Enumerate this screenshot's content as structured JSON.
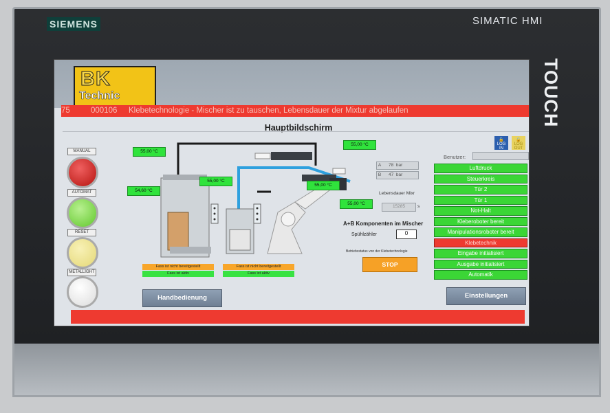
{
  "device": {
    "brand": "SIEMENS",
    "model": "SIMATIC HMI",
    "touch_label": "TOUCH"
  },
  "logo": {
    "line1": "BK",
    "line2": "Technic"
  },
  "alarm": {
    "number": "75",
    "code": "000106",
    "text": "Klebetechnologie - Mischer ist zu tauschen, Lebensdauer der Mixtur abgelaufen"
  },
  "screen_title": "Hauptbildschirm",
  "side_lamps": [
    {
      "label": "MANUAL",
      "color": "#d02020"
    },
    {
      "label": "AUTOMAT",
      "color": "#7ee048"
    },
    {
      "label": "RESET",
      "color": "#f0e69a"
    },
    {
      "label": "METALLIGHT",
      "color": "#f4f4f4"
    }
  ],
  "temperatures": [
    {
      "id": "t1",
      "value": "55,00",
      "unit": "°C"
    },
    {
      "id": "t2",
      "value": "54,60",
      "unit": "°C"
    },
    {
      "id": "t3",
      "value": "55,00",
      "unit": "°C"
    },
    {
      "id": "t4",
      "value": "55,00",
      "unit": "°C"
    },
    {
      "id": "t5",
      "value": "55,00",
      "unit": "°C"
    },
    {
      "id": "t6",
      "value": "55,00",
      "unit": "°C"
    }
  ],
  "pressure": [
    {
      "label": "A",
      "value": "78",
      "unit": "bar"
    },
    {
      "label": "B",
      "value": "47",
      "unit": "bar"
    }
  ],
  "mixer": {
    "life_label": "Lebensdauer Mixr",
    "life_value": "15285",
    "life_unit": "s",
    "components_label": "A+B Komponenten im Mischer",
    "flush_label": "Spühlzähler",
    "flush_value": "0",
    "operation_label": "Betriebsstatus von der Klebetechnologie",
    "stop_label": "STOP"
  },
  "barrels": [
    {
      "status1": "Fass ist nicht bereitgestellt",
      "status2": "Fass ist aktiv"
    },
    {
      "status1": "Fass ist nicht bereitgestellt",
      "status2": "Fass ist aktiv"
    }
  ],
  "user": {
    "label": "Benutzer:",
    "value": ""
  },
  "login": {
    "login_label": "LOG IN",
    "logout_label": "LOG OUT"
  },
  "status_list": [
    {
      "label": "Luftdruck",
      "state": "ok"
    },
    {
      "label": "Steuerkreis",
      "state": "ok"
    },
    {
      "label": "Tür 2",
      "state": "ok"
    },
    {
      "label": "Tür 1",
      "state": "ok"
    },
    {
      "label": "Not-Halt",
      "state": "ok"
    },
    {
      "label": "Kleberoboter bereit",
      "state": "ok"
    },
    {
      "label": "Manipulationsroboter bereit",
      "state": "ok"
    },
    {
      "label": "Klebetechnik",
      "state": "error"
    },
    {
      "label": "Eingabe initialisiert",
      "state": "ok"
    },
    {
      "label": "Ausgabe initialisiert",
      "state": "ok"
    },
    {
      "label": "Automatik",
      "state": "ok"
    }
  ],
  "buttons": {
    "manual": "Handbedienung",
    "settings": "Einstellungen"
  },
  "colors": {
    "alarm_red": "#ee3a30",
    "ok_green": "#3bd636",
    "warn_orange": "#f6a126",
    "button_blue": "#7e8fa4"
  }
}
